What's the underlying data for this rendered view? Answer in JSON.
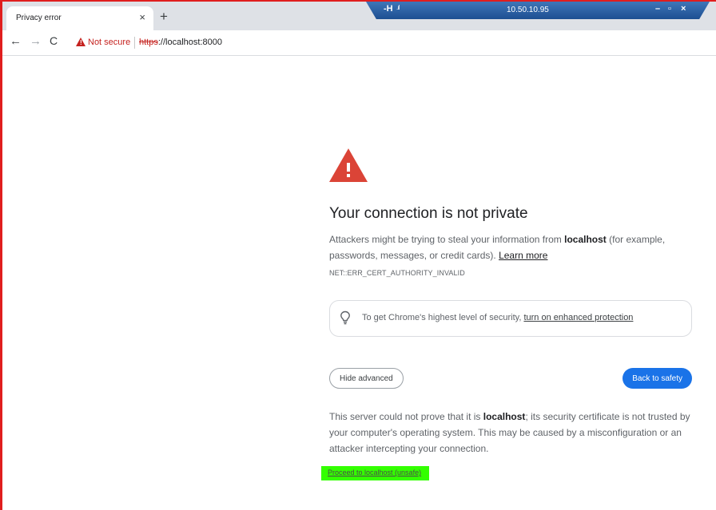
{
  "browser": {
    "tab_title": "Privacy error",
    "tab_close": "×",
    "new_tab": "+",
    "nav": {
      "back": "←",
      "forward": "→",
      "reload": "C"
    },
    "omnibox": {
      "security_label": "Not secure",
      "url_scheme": "https",
      "url_rest": "://localhost:8000"
    }
  },
  "remote_bar": {
    "pin": "-H",
    "signal": ".ıl",
    "ip": "10.50.10.95",
    "minimize": "–",
    "restore": "▫",
    "close": "×"
  },
  "page": {
    "heading": "Your connection is not private",
    "intro_before": "Attackers might be trying to steal your information from ",
    "intro_host": "localhost",
    "intro_after": " (for example, passwords, messages, or credit cards). ",
    "learn_more": "Learn more",
    "error_code": "NET::ERR_CERT_AUTHORITY_INVALID",
    "enhanced_before": "To get Chrome's highest level of security, ",
    "enhanced_link": "turn on enhanced protection",
    "hide_advanced": "Hide advanced",
    "back_to_safety": "Back to safety",
    "advanced_before": "This server could not prove that it is ",
    "advanced_host": "localhost",
    "advanced_after": "; its security certificate is not trusted by your computer's operating system. This may be caused by a misconfiguration or an attacker intercepting your connection.",
    "proceed_link": "Proceed to localhost (unsafe)"
  },
  "colors": {
    "danger_red": "#db4437",
    "primary_blue": "#1a73e8",
    "highlight_green": "#33ff00",
    "frame_red": "#e01e1e"
  }
}
